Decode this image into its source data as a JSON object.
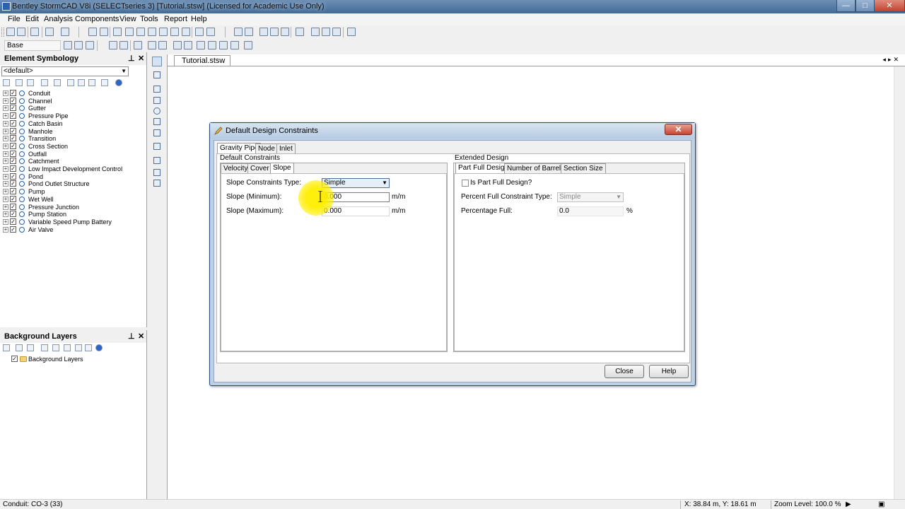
{
  "window": {
    "title": "Bentley StormCAD V8i (SELECTseries 3) [Tutorial.stsw] (Licensed for Academic Use Only)",
    "controls": {
      "minimize": "—",
      "maximize": "□",
      "close": "✕"
    }
  },
  "menu": [
    "File",
    "Edit",
    "Analysis",
    "Components",
    "View",
    "Tools",
    "Report",
    "Help"
  ],
  "toolbar": {
    "scenario_select": "Base"
  },
  "element_symbology": {
    "title": "Element Symbology",
    "pin_icon": "pin-icon",
    "close_icon": "✕",
    "selector": "<default>",
    "items": [
      {
        "label": "Conduit",
        "icon": "conduit-icon"
      },
      {
        "label": "Channel",
        "icon": "channel-icon"
      },
      {
        "label": "Gutter",
        "icon": "gutter-icon"
      },
      {
        "label": "Pressure Pipe",
        "icon": "pressure-pipe-icon"
      },
      {
        "label": "Catch Basin",
        "icon": "catch-basin-icon"
      },
      {
        "label": "Manhole",
        "icon": "manhole-icon"
      },
      {
        "label": "Transition",
        "icon": "transition-icon"
      },
      {
        "label": "Cross Section",
        "icon": "cross-section-icon"
      },
      {
        "label": "Outfall",
        "icon": "outfall-icon"
      },
      {
        "label": "Catchment",
        "icon": "catchment-icon"
      },
      {
        "label": "Low Impact Development Control",
        "icon": "lid-control-icon"
      },
      {
        "label": "Pond",
        "icon": "pond-icon"
      },
      {
        "label": "Pond Outlet Structure",
        "icon": "pond-outlet-icon"
      },
      {
        "label": "Pump",
        "icon": "pump-icon"
      },
      {
        "label": "Wet Well",
        "icon": "wet-well-icon"
      },
      {
        "label": "Pressure Junction",
        "icon": "pressure-junction-icon"
      },
      {
        "label": "Pump Station",
        "icon": "pump-station-icon"
      },
      {
        "label": "Variable Speed Pump Battery",
        "icon": "vspb-icon"
      },
      {
        "label": "Air Valve",
        "icon": "air-valve-icon"
      }
    ]
  },
  "background_layers": {
    "title": "Background Layers",
    "items": [
      {
        "label": "Background Layers",
        "icon": "folder-icon"
      }
    ]
  },
  "document": {
    "tab": "Tutorial.stsw"
  },
  "dialog": {
    "title": "Default Design Constraints",
    "main_tabs": [
      "Gravity Pipe",
      "Node",
      "Inlet"
    ],
    "left_group": {
      "title": "Default Constraints",
      "tabs": [
        "Velocity",
        "Cover",
        "Slope"
      ],
      "fields": {
        "type_label": "Slope Constraints Type:",
        "type_value": "Simple",
        "min_label": "Slope (Minimum):",
        "min_value": "0.000",
        "min_unit": "m/m",
        "max_label": "Slope (Maximum):",
        "max_value": "0.000",
        "max_unit": "m/m"
      }
    },
    "right_group": {
      "title": "Extended Design",
      "tabs": [
        "Part Full Design",
        "Number of Barrels",
        "Section Size"
      ],
      "fields": {
        "checkbox_label": "Is Part Full Design?",
        "constraint_label": "Percent Full Constraint Type:",
        "constraint_value": "Simple",
        "pct_label": "Percentage Full:",
        "pct_value": "0.0",
        "pct_unit": "%"
      }
    },
    "buttons": {
      "close": "Close",
      "help": "Help"
    }
  },
  "status": {
    "selection": "Conduit:  CO-3 (33)",
    "coords": "X: 38.84 m, Y: 18.61 m",
    "zoom": "Zoom Level: 100.0 %"
  },
  "colors": {
    "highlight": "#ffee00",
    "title_bar": "#4a74a3"
  }
}
